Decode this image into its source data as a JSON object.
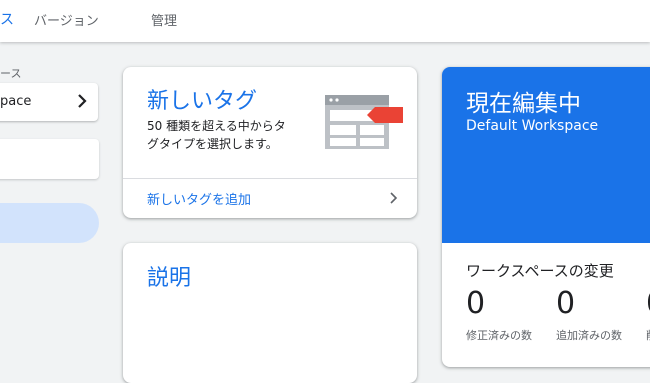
{
  "header": {
    "active_tab_fragment": "ス",
    "tabs": [
      {
        "label": "バージョン"
      },
      {
        "label": "管理"
      }
    ]
  },
  "sidebar": {
    "workspace_label": "ース",
    "workspace_value": "pace"
  },
  "new_tag_card": {
    "title": "新しいタグ",
    "description": "50 種類を超える中からタグタイプを選択します。",
    "link_label": "新しいタグを追加"
  },
  "description_card": {
    "title": "説明"
  },
  "editing_card": {
    "title": "現在編集中",
    "workspace_name": "Default Workspace",
    "changes_title": "ワークスペースの変更",
    "stats": [
      {
        "value": "0",
        "label": "修正済みの数"
      },
      {
        "value": "0",
        "label": "追加済みの数"
      },
      {
        "value": "0",
        "label": "削"
      }
    ]
  },
  "colors": {
    "accent": "#1a73e8",
    "tag_red": "#ea4335",
    "nav_highlight": "#d2e3fc"
  }
}
